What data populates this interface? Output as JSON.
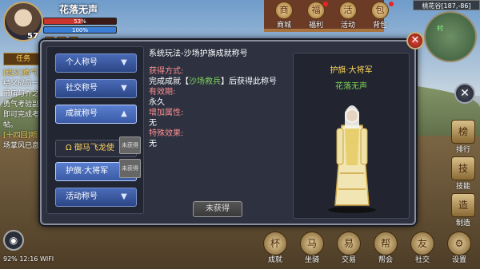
{
  "player": {
    "name": "花落无声",
    "level": "57",
    "hp_text": "53%",
    "hp_fraction": 0.53,
    "mp_text": "100%"
  },
  "top_menu": [
    {
      "label": "商城",
      "icon": "mall-icon"
    },
    {
      "label": "福利",
      "icon": "gift-icon"
    },
    {
      "label": "活动",
      "icon": "event-icon"
    },
    {
      "label": "背包",
      "icon": "bag-icon"
    }
  ],
  "minimap": {
    "location": "桃花谷[187,-86]",
    "marker": "村"
  },
  "quest": {
    "tab": "任务",
    "text1_tag": "[结义]",
    "text1_title": "勇气",
    "lines": [
      "结义成员一",
      "帝庙与乔之",
      "勇气考验副",
      "即可完成考",
      "帖。"
    ],
    "text2_tag": "[十四回]",
    "text2_title": "听",
    "text2_line": "场掌风已息"
  },
  "dialog": {
    "tabs": [
      {
        "label": "个人称号",
        "arrow": "▼"
      },
      {
        "label": "社交称号",
        "arrow": "▼"
      },
      {
        "label": "成就称号",
        "arrow": "▲"
      }
    ],
    "sub_items": [
      {
        "label": "御马飞龙使",
        "prefix": "Ω",
        "tag": "未获得"
      },
      {
        "label": "护旗·大将军",
        "tag": "未获得"
      }
    ],
    "last_tab": {
      "label": "活动称号",
      "arrow": "▼"
    },
    "detail": {
      "title": "系统玩法-沙场护旗成就称号",
      "how_label": "获得方式:",
      "how_text_pre": "完成成就【",
      "how_link": "沙场救兵",
      "how_text_post": "】后获得此称号",
      "validity_label": "有效期:",
      "validity_value": "永久",
      "attr_label": "增加属性:",
      "attr_value": "无",
      "effect_label": "特殊效果:",
      "effect_value": "无"
    },
    "button": "未获得",
    "preview": {
      "title": "护旗·大将军",
      "name": "花落无声"
    }
  },
  "right_buttons": [
    {
      "label": "排行",
      "icon": "rank-icon"
    },
    {
      "label": "技能",
      "icon": "skill-icon"
    },
    {
      "label": "制造",
      "icon": "craft-icon"
    }
  ],
  "bottom_buttons": [
    {
      "label": "成就",
      "icon": "achievement-icon"
    },
    {
      "label": "坐骑",
      "icon": "mount-icon"
    },
    {
      "label": "交易",
      "icon": "trade-icon"
    },
    {
      "label": "帮会",
      "icon": "guild-icon"
    },
    {
      "label": "社交",
      "icon": "social-icon"
    },
    {
      "label": "设置",
      "icon": "settings-icon"
    }
  ],
  "status": {
    "battery": "92%",
    "time": "12:16",
    "network": "WIFI"
  },
  "colors": {
    "tab_blue": "#3a5aa4",
    "gold_text": "#ffd45a",
    "green_text": "#7fd55a",
    "label_red": "#ff8f8f"
  }
}
